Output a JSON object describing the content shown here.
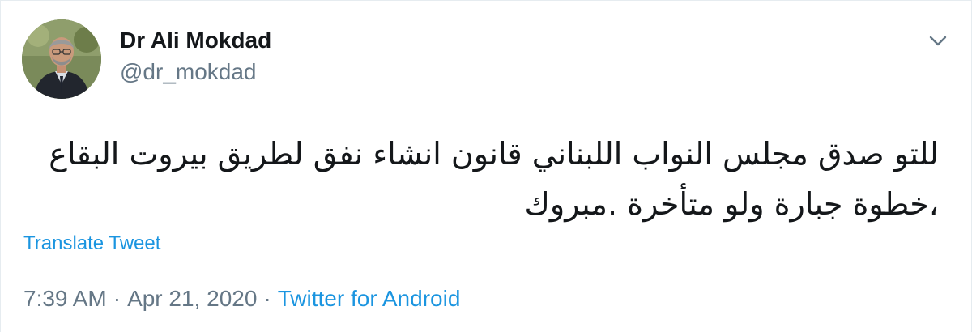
{
  "author": {
    "display_name": "Dr Ali Mokdad",
    "handle": "@dr_mokdad"
  },
  "tweet": {
    "text": "للتو صدق مجلس النواب اللبناني قانون انشاء نفق لطريق بيروت البقاع ،خطوة جبارة ولو متأخرة .مبروك",
    "translate_label": "Translate Tweet",
    "time": "7:39 AM",
    "date": "Apr 21, 2020",
    "source": "Twitter for Android",
    "separator": "·"
  },
  "icons": {
    "menu": "chevron-down-icon"
  },
  "colors": {
    "link": "#1b95e0",
    "secondary_text": "#657786",
    "primary_text": "#14171a"
  }
}
